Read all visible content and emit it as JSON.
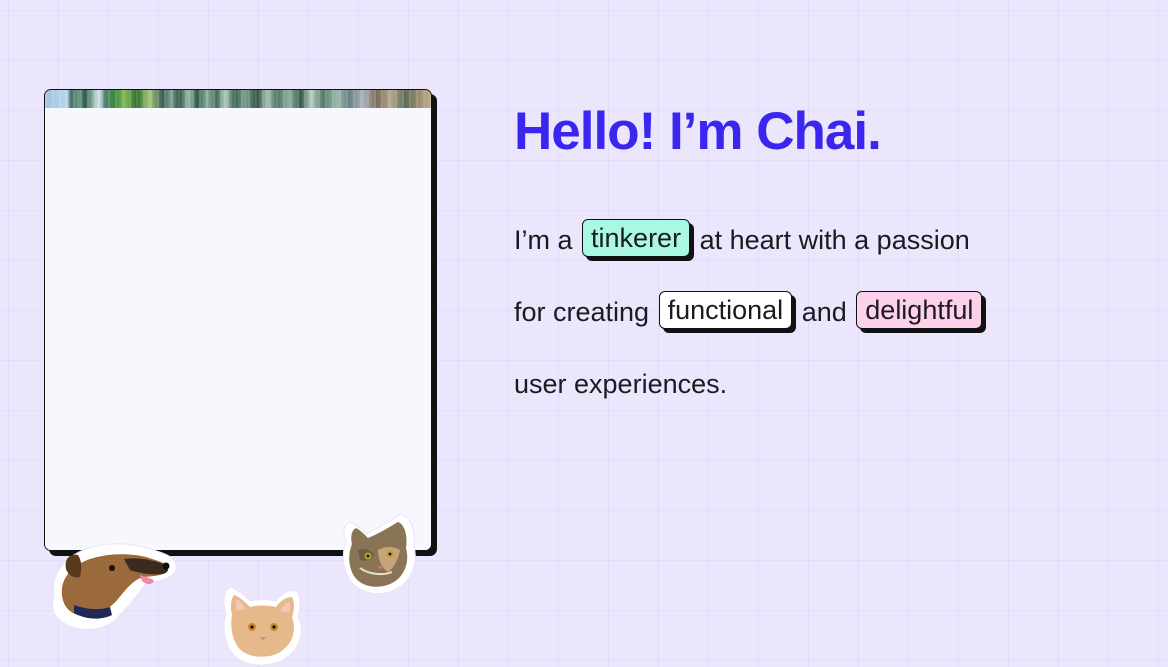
{
  "hero": {
    "title": "Hello! I’m Chai.",
    "intro": {
      "line1_prefix": "I’m a",
      "tag_tinkerer": "tinkerer",
      "line1_suffix": "at heart with a passion",
      "line2_prefix": "for creating",
      "tag_functional": "functional",
      "line2_middle": "and",
      "tag_delightful": "delightful",
      "line3": "user experiences."
    }
  },
  "stickers": {
    "dog": "dog-sticker",
    "cat_orange": "orange-cat-sticker",
    "cat_tabby": "tabby-cat-sticker"
  },
  "colors": {
    "background": "#ebe6fc",
    "headline": "#3b26f0",
    "body_text": "#1b1b1f",
    "tag_tinkerer_bg": "#a8f8e4",
    "tag_functional_bg": "#ffffff",
    "tag_delightful_bg": "#fdd1ea",
    "card_bg": "#f7f8fe",
    "outline": "#111111"
  }
}
